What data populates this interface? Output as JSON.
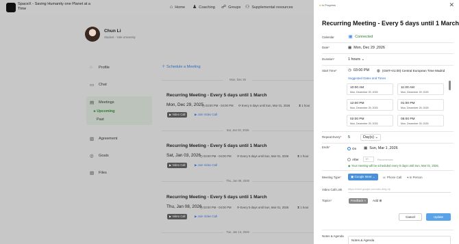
{
  "app": {
    "brand": "SpaceX - Saving Humanity one Planet at a Time",
    "nav": [
      {
        "label": "Home",
        "icon": "home-icon",
        "glyph": "⌂"
      },
      {
        "label": "Coaching",
        "icon": "coaching-icon",
        "glyph": "♟"
      },
      {
        "label": "Groups",
        "icon": "groups-icon",
        "glyph": "☍"
      },
      {
        "label": "Supplemental resources",
        "icon": "resources-icon",
        "glyph": "⚇"
      }
    ]
  },
  "profile": {
    "name": "Chun Li",
    "subtitle": "Student - Yale University"
  },
  "sidebar": {
    "items": [
      {
        "label": "Profile",
        "icon": "profile-icon",
        "glyph": "◌"
      },
      {
        "label": "Chat",
        "icon": "chat-icon",
        "glyph": "▭"
      },
      {
        "label": "Meetings",
        "icon": "meetings-icon",
        "glyph": "▤"
      },
      {
        "label": "Agreement",
        "icon": "agreement-icon",
        "glyph": "▥"
      },
      {
        "label": "Goals",
        "icon": "goals-icon",
        "glyph": "◎"
      },
      {
        "label": "Files",
        "icon": "files-icon",
        "glyph": "▧"
      }
    ],
    "sub_items": [
      {
        "label": "Upcoming"
      },
      {
        "label": "Past"
      }
    ]
  },
  "schedule_label": "Schedule a Meeting",
  "timeline": [
    {
      "date_sep": "Mon, Dec 29",
      "title": "Recurring Meeting - Every 5 days until 1 March",
      "date": "Mon, Dec 29, 2025",
      "time": "03:00 PM - 04:00 PM",
      "recurrence": "Every 5 days until Sun, Mar 01, 2026",
      "duration": "1 hour",
      "video": "Video Call",
      "join": "Join Video Call"
    },
    {
      "date_sep": "Sat, Jan 03, 2026",
      "title": "Recurring Meeting - Every 5 days until 1 March",
      "date": "Sat, Jan 03, 2026",
      "time": "03:00 PM - 04:00 PM",
      "recurrence": "Every 5 days until Sun, Mar 01, 2026",
      "duration": "1 hour",
      "video": "Video Call",
      "join": "Join Video Call"
    },
    {
      "date_sep": "Thu, Jan 08, 2026",
      "title": "Recurring Meeting - Every 5 days until 1 March",
      "date": "Thu, Jan 08, 2026",
      "time": "03:00 PM - 04:00 PM",
      "recurrence": "Every 5 days until Sun, Mar 01, 2026",
      "duration": "1 hour",
      "video": "Video Call",
      "join": "Join Video Call"
    }
  ],
  "last_date_sep": "Tue, Jan 13, 2026",
  "panel": {
    "status": "In Progress",
    "title": "Recurring Meeting - Every 5 days until 1 March",
    "calendar_label": "Calendar",
    "calendar_value": "Connected",
    "date_label": "Date",
    "date_value": "Mon, Dec 29 ,2026",
    "duration_label": "Duration",
    "duration_value": "1 hours",
    "start_label": "Start Time",
    "start_value": "03:00 PM",
    "timezone": "(GMT+01:00) Central European Time Madrid",
    "suggested_label": "Suggested Dates and Times",
    "slots": [
      {
        "time": "10:00 AM",
        "date": "Mon, December 29, 2025"
      },
      {
        "time": "11:00 AM",
        "date": "Mon, December 29, 2025"
      },
      {
        "time": "12:00 PM",
        "date": "Mon, December 29, 2025"
      },
      {
        "time": "01:00 PM",
        "date": "Mon, December 29, 2025"
      },
      {
        "time": "02:00 PM",
        "date": "Mon, December 29, 2025"
      },
      {
        "time": "05:00 PM",
        "date": "Mon, December 29, 2025"
      }
    ],
    "repeat_label": "Repeat Every",
    "repeat_value": "5",
    "repeat_unit": "Day(s)",
    "ends_label": "Ends",
    "ends_on": "On",
    "ends_on_date": "Sun, Mar 1 ,2026",
    "ends_after": "After",
    "ends_after_value": "10",
    "ends_after_unit": "Recurrences",
    "schedule_note": "Your meeting will be scheduled every 5 days until Sun, Mar 01, 2026.",
    "type_label": "Meeting Type",
    "type_selected": "Google Meet",
    "type_phone": "Phone Call",
    "type_person": "In Person",
    "link_label": "Video Call Link",
    "link_placeholder": "https://meet.google.com/abc-defg-hij",
    "topics_label": "Topics",
    "topic_chip": "Feedback",
    "add_label": "Add",
    "cancel": "Cancel",
    "update": "Update",
    "notes_label": "Notes & Agenda",
    "notes_value": "Notes & Agenda"
  },
  "colors": {
    "accent": "#2f6fc6",
    "success": "#2e7d32",
    "update_btn": "#5aa3e8",
    "meet_btn": "#4a90d9"
  }
}
